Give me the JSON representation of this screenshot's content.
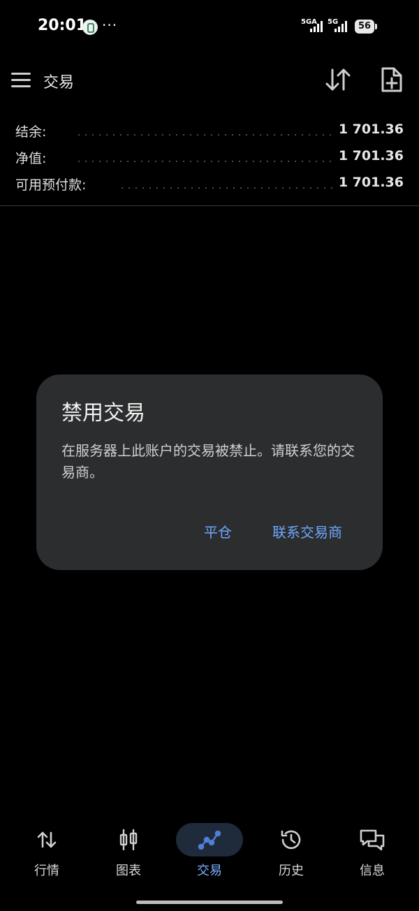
{
  "status_bar": {
    "time": "20:01",
    "more": "···",
    "network_1": "5GA",
    "network_2": "5G",
    "battery": "56"
  },
  "app_bar": {
    "title": "交易",
    "icons": [
      "menu-icon",
      "sort-icon",
      "new-order-icon"
    ]
  },
  "summary": [
    {
      "label": "结余:",
      "value": "1 701.36"
    },
    {
      "label": "净值:",
      "value": "1 701.36"
    },
    {
      "label": "可用预付款:",
      "value": "1 701.36"
    }
  ],
  "dialog": {
    "title": "禁用交易",
    "message": "在服务器上此账户的交易被禁止。请联系您的交易商。",
    "close_button": "平仓",
    "contact_button": "联系交易商",
    "accent_color": "#6ea8ff"
  },
  "bottom_nav": [
    {
      "label": "行情",
      "icon": "quotes-icon",
      "active": false
    },
    {
      "label": "图表",
      "icon": "chart-icon",
      "active": false
    },
    {
      "label": "交易",
      "icon": "trade-icon",
      "active": true
    },
    {
      "label": "历史",
      "icon": "history-icon",
      "active": false
    },
    {
      "label": "信息",
      "icon": "messages-icon",
      "active": false
    }
  ]
}
